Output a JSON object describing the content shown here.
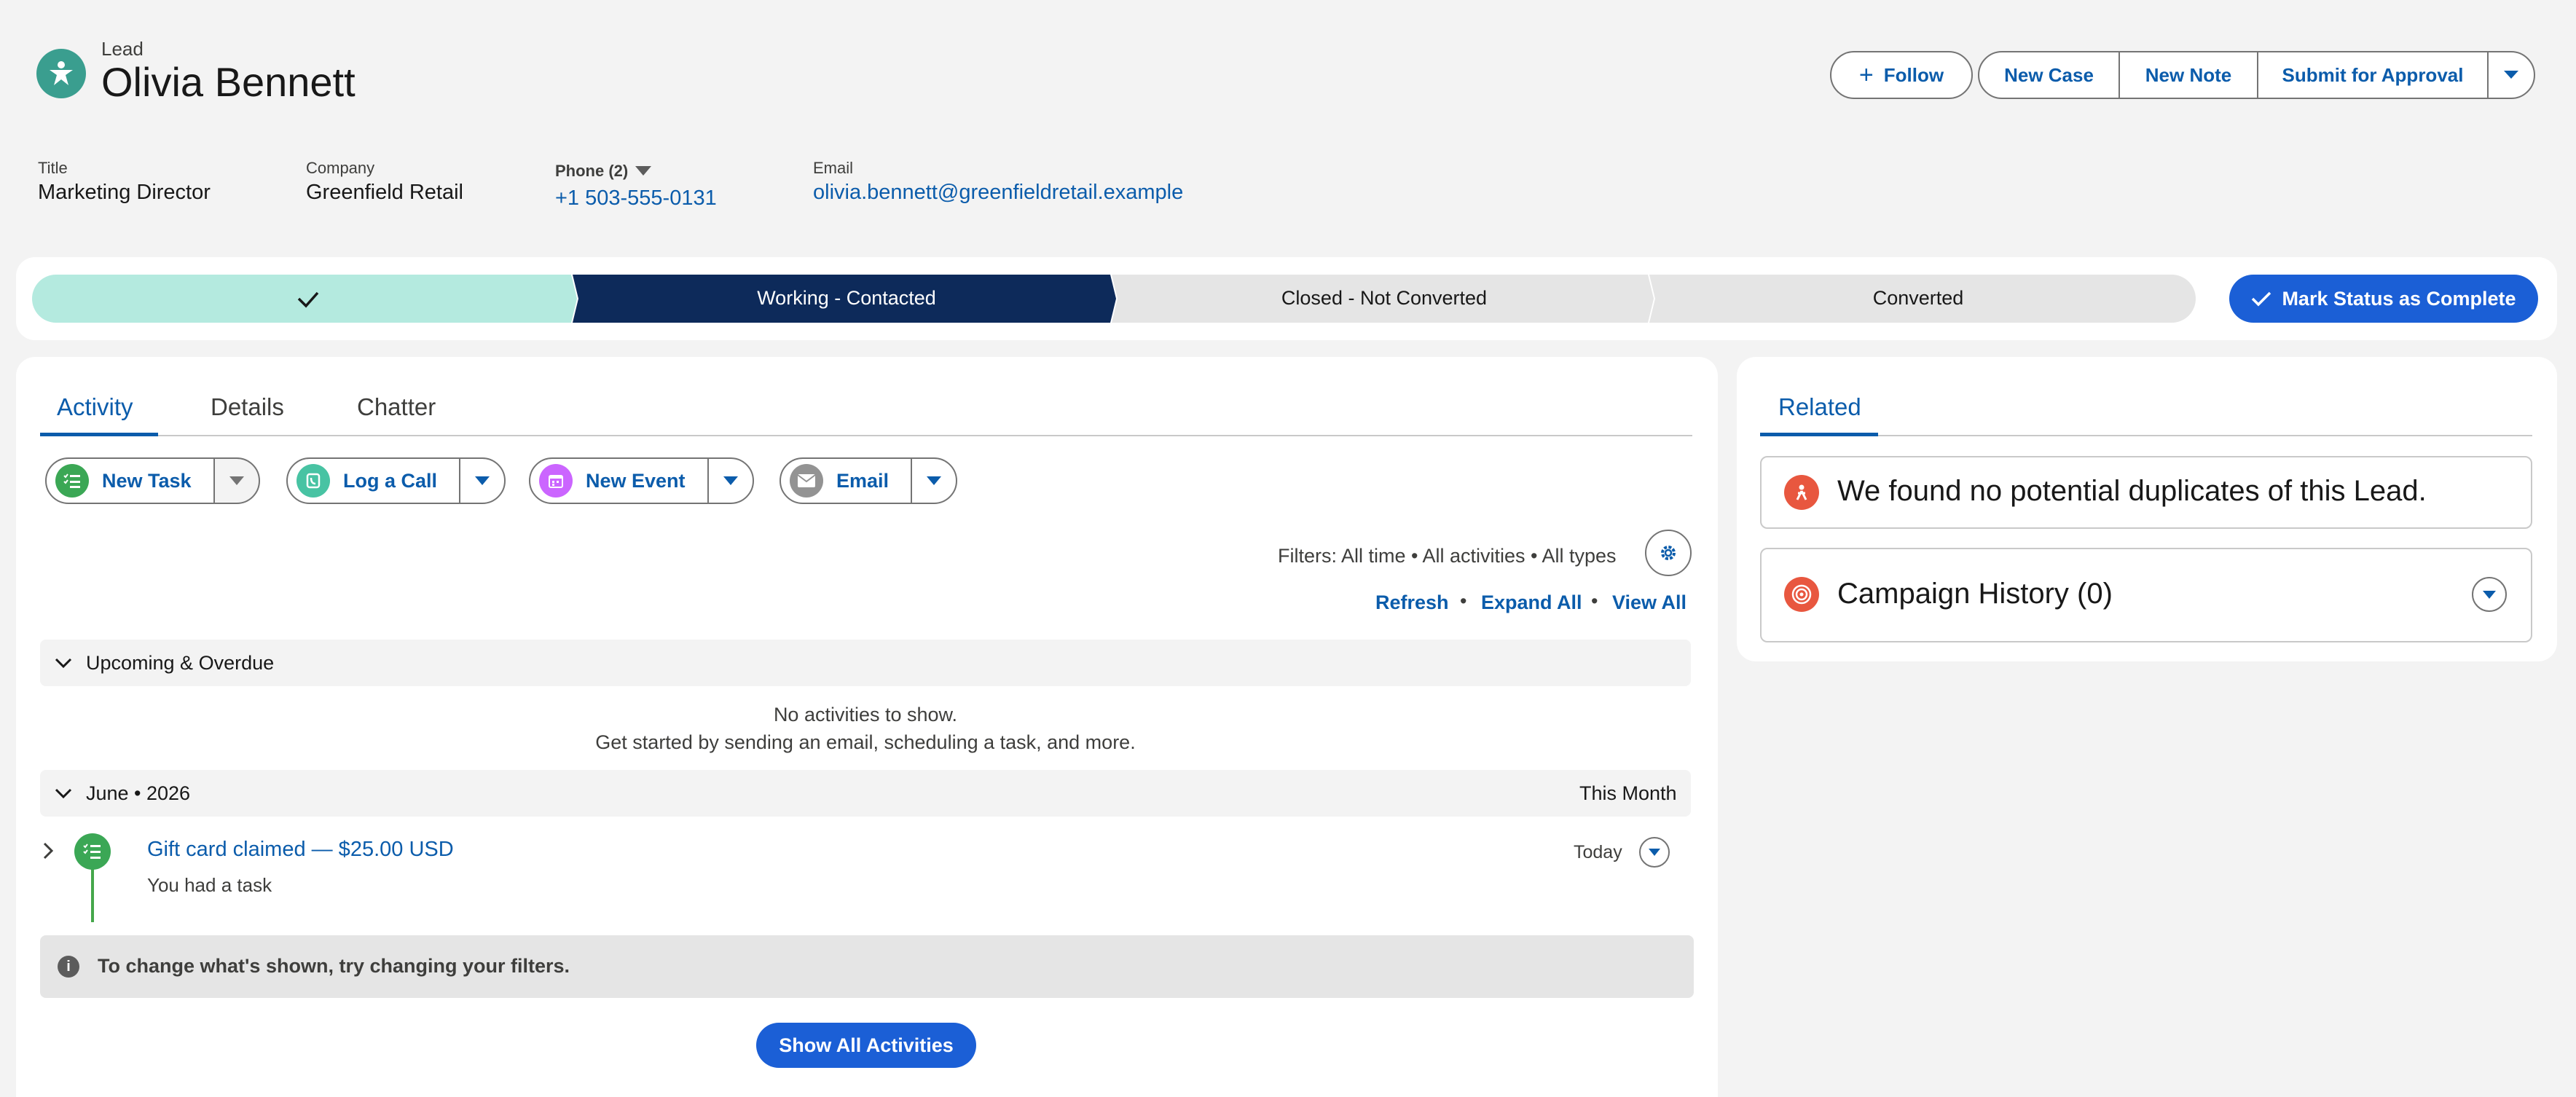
{
  "header": {
    "object_label": "Lead",
    "record_name": "Olivia Bennett",
    "icon": "lead-icon",
    "follow_label": "Follow",
    "actions": [
      "New Case",
      "New Note",
      "Submit for Approval"
    ]
  },
  "highlights": {
    "title_label": "Title",
    "title_value": "Marketing Director",
    "company_label": "Company",
    "company_value": "Greenfield Retail",
    "phone_label": "Phone (2)",
    "phone_value": "+1 503-555-0131",
    "email_label": "Email",
    "email_value": "olivia.bennett@greenfieldretail.example"
  },
  "path": {
    "stages": [
      "",
      "Working - Contacted",
      "Closed - Not Converted",
      "Converted"
    ],
    "current_stage": "Working - Contacted",
    "mark_complete_label": "Mark Status as Complete",
    "colors": {
      "complete": "#b4eadf",
      "current": "#0d2a5a",
      "incomplete": "#e5e5e5"
    }
  },
  "activity": {
    "tabs": [
      "Activity",
      "Details",
      "Chatter"
    ],
    "active_tab": "Activity",
    "buttons": [
      {
        "label": "New Task",
        "icon": "task-icon",
        "color": "#3ba755"
      },
      {
        "label": "Log a Call",
        "icon": "phone-icon",
        "color": "#48c3a3"
      },
      {
        "label": "New Event",
        "icon": "calendar-icon",
        "color": "#cb65ff"
      },
      {
        "label": "Email",
        "icon": "envelope-icon",
        "color": "#939393"
      }
    ],
    "filters_text": "Filters: All time • All activities • All types",
    "links": [
      "Refresh",
      "Expand All",
      "View All"
    ],
    "upcoming_title": "Upcoming & Overdue",
    "empty_line1": "No activities to show.",
    "empty_line2": "Get started by sending an email, scheduling a task, and more.",
    "month_title": "June • 2026",
    "month_badge": "This Month",
    "item": {
      "title": "Gift card claimed — $25.00 USD",
      "subtitle": "You had a task",
      "date": "Today"
    },
    "info_text": "To change what's shown, try changing your filters.",
    "show_all_label": "Show All Activities"
  },
  "related": {
    "tab": "Related",
    "duplicates_text": "We found no potential duplicates of this Lead.",
    "campaign_text": "Campaign History (0)"
  }
}
